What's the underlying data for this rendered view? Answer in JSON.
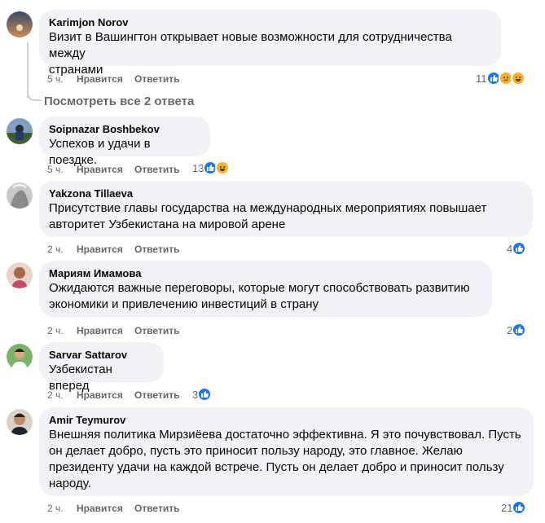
{
  "comments": [
    {
      "author": "Karimjon Norov",
      "text_lines": [
        "Визит в Вашингтон открывает новые возможности для сотрудничества между",
        "странами"
      ],
      "time": "5 ч.",
      "like_label": "Нравится",
      "reply_label": "Ответить",
      "reaction_count": "11",
      "reactions": [
        "like-icon",
        "sad-icon",
        "haha-icon"
      ]
    },
    {
      "author": "Soipnazar Boshbekov",
      "text_lines": [
        "Успехов и удачи в поездке."
      ],
      "time": "5 ч.",
      "like_label": "Нравится",
      "reply_label": "Ответить",
      "reaction_count": "13",
      "reactions": [
        "like-icon",
        "haha-icon"
      ]
    },
    {
      "author": "Yakzona Tillaeva",
      "text_lines": [
        "Присутствие главы государства на международных мероприятиях повышает",
        "авторитет Узбекистана на мировой арене"
      ],
      "time": "2 ч.",
      "like_label": "Нравится",
      "reply_label": "Ответить",
      "reaction_count": "4",
      "reactions": [
        "like-icon"
      ]
    },
    {
      "author": "Мариям Имамова",
      "text_lines": [
        "Ожидаются важные переговоры, которые могут способствовать развитию",
        "экономики и привлечению инвестиций в страну"
      ],
      "time": "2 ч.",
      "like_label": "Нравится",
      "reply_label": "Ответить",
      "reaction_count": "2",
      "reactions": [
        "like-icon"
      ]
    },
    {
      "author": "Sarvar Sattarov",
      "text_lines": [
        "Узбекистан вперед"
      ],
      "time": "2 ч.",
      "like_label": "Нравится",
      "reply_label": "Ответить",
      "reaction_count": "3",
      "reactions": [
        "like-icon"
      ]
    },
    {
      "author": "Amir Teymurov",
      "text_lines": [
        "Внешняя политика Мирзиёева достаточно эффективна. Я это почувствовал. Пусть",
        "он делает добро, пусть это приносит пользу народу, это главное. Желаю",
        "президенту удачи на каждой встрече. Пусть он делает добро и приносит пользу",
        "народу."
      ],
      "time": "2 ч.",
      "like_label": "Нравится",
      "reply_label": "Ответить",
      "reaction_count": "21",
      "reactions": [
        "like-icon"
      ]
    }
  ],
  "view_replies_label": "Посмотреть все 2 ответа",
  "colors": {
    "bubble": "#f0f2f5",
    "meta_text": "#65676b",
    "like_blue": "#1877f2",
    "emoji_yellow": "#f7b125"
  }
}
